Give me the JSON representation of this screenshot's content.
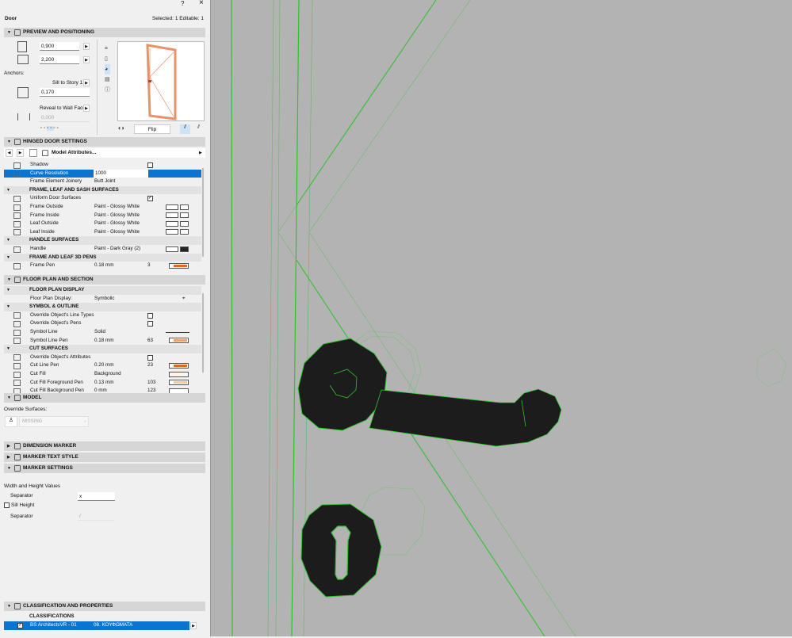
{
  "window": {
    "help": "?",
    "close": "×",
    "object_type": "Door",
    "selection": "Selected: 1 Editable: 1"
  },
  "preview": {
    "title": "PREVIEW AND POSITIONING",
    "width": "0,900",
    "height": "2,200",
    "anchors_label": "Anchors:",
    "sill_anchor": "Sill to Story 1",
    "sill_value": "0,170",
    "reveal_anchor": "Reveal to Wall Face",
    "reveal_value": "0,000",
    "flip_label": "Flip"
  },
  "hinged": {
    "title": "HINGED DOOR SETTINGS",
    "model_attributes": "Model Attributes...",
    "rows": [
      {
        "type": "item",
        "label": "Shadow",
        "check": false,
        "icon": "shadow-icon"
      },
      {
        "type": "item",
        "label": "Curve Resolution",
        "value": "1000",
        "selected": true,
        "icon": "curve-icon"
      },
      {
        "type": "item",
        "label": "Frame Element Joinery",
        "value": "Butt Joint"
      },
      {
        "type": "header",
        "label": "FRAME, LEAF AND SASH SURFACES"
      },
      {
        "type": "item",
        "label": "Uniform Door Surfaces",
        "check": true,
        "icon": "surface-icon"
      },
      {
        "type": "item",
        "label": "Frame Outside",
        "value": "Paint - Glossy White",
        "swatch": [
          "#ffffff",
          "#ffffff"
        ],
        "icon": "surface-icon"
      },
      {
        "type": "item",
        "label": "Frame Inside",
        "value": "Paint - Glossy White",
        "swatch": [
          "#ffffff",
          "#ffffff"
        ],
        "icon": "surface-icon"
      },
      {
        "type": "item",
        "label": "Leaf Outside",
        "value": "Paint - Glossy White",
        "swatch": [
          "#ffffff",
          "#ffffff"
        ],
        "icon": "surface-icon"
      },
      {
        "type": "item",
        "label": "Leaf Inside",
        "value": "Paint - Glossy White",
        "swatch": [
          "#ffffff",
          "#ffffff"
        ],
        "icon": "surface-icon"
      },
      {
        "type": "header",
        "label": "HANDLE SURFACES"
      },
      {
        "type": "item",
        "label": "Handle",
        "value": "Paint - Dark Gray (2)",
        "swatch": [
          "#ffffff",
          "#222222"
        ],
        "icon": "surface-icon"
      },
      {
        "type": "header",
        "label": "FRAME AND LEAF 3D PENS"
      },
      {
        "type": "item",
        "label": "Frame Pen",
        "value": "0.18 mm",
        "num": "3",
        "pen": "#e8641e",
        "icon": "pen-icon"
      }
    ]
  },
  "floorplan": {
    "title": "FLOOR PLAN AND SECTION",
    "rows": [
      {
        "type": "header",
        "label": "FLOOR PLAN DISPLAY"
      },
      {
        "type": "item",
        "label": "Floor Plan Display:",
        "value": "Symbolic",
        "icon_right": "symbol-icon"
      },
      {
        "type": "header",
        "label": "SYMBOL & OUTLINE"
      },
      {
        "type": "item",
        "label": "Override Object's Line Types",
        "check": false,
        "icon": "line-type-icon"
      },
      {
        "type": "item",
        "label": "Override Object's Pens",
        "check": false,
        "icon": "pen-icon"
      },
      {
        "type": "item",
        "label": "Symbol Line",
        "value": "Solid",
        "line": true,
        "icon": "line-icon"
      },
      {
        "type": "item",
        "label": "Symbol Line Pen",
        "value": "0.18 mm",
        "num": "63",
        "pen": "#f4a06a",
        "icon": "pen-icon"
      },
      {
        "type": "header",
        "label": "CUT SURFACES"
      },
      {
        "type": "item",
        "label": "Override Object's Attributes",
        "check": false,
        "icon": "attributes-icon"
      },
      {
        "type": "item",
        "label": "Cut Line Pen",
        "value": "0.20 mm",
        "num": "23",
        "pen": "#e8641e",
        "icon": "pen-icon"
      },
      {
        "type": "item",
        "label": "Cut Fill",
        "value": "Background",
        "fill": "#fff4ea",
        "icon": "fill-icon"
      },
      {
        "type": "item",
        "label": "Cut Fill Foreground Pen",
        "value": "0.13 mm",
        "num": "103",
        "pen": "#f8c89c",
        "icon": "pen-icon"
      },
      {
        "type": "item",
        "label": "Cut Fill Background Pen",
        "value": "0 mm",
        "num": "123",
        "pen": "#ffffff",
        "icon": "pen-icon"
      }
    ]
  },
  "model": {
    "title": "MODEL",
    "override_label": "Override Surfaces:",
    "override_value": "MISSING"
  },
  "dimension_marker": {
    "title": "DIMENSION MARKER"
  },
  "marker_text_style": {
    "title": "MARKER TEXT STYLE"
  },
  "marker_settings": {
    "title": "MARKER SETTINGS",
    "wh_label": "Width and Height Values",
    "separator_label": "Separator",
    "separator_value": "x",
    "sill_height_label": "Sill Height",
    "sill_separator_label": "Separator",
    "sill_separator_value": "/"
  },
  "classification": {
    "title": "CLASSIFICATION AND PROPERTIES",
    "sub": "CLASSIFICATIONS",
    "system": "BS ArchitectsVR - 01",
    "value": "08. ΚΟΥΦΩΜΑΤΑ"
  },
  "colors": {
    "selection": "#0a74d0",
    "wire": "#2ec32e",
    "handle": "#1c1c1c",
    "viewport_bg": "#b3b3b3",
    "door_preview": "#e8926a"
  }
}
